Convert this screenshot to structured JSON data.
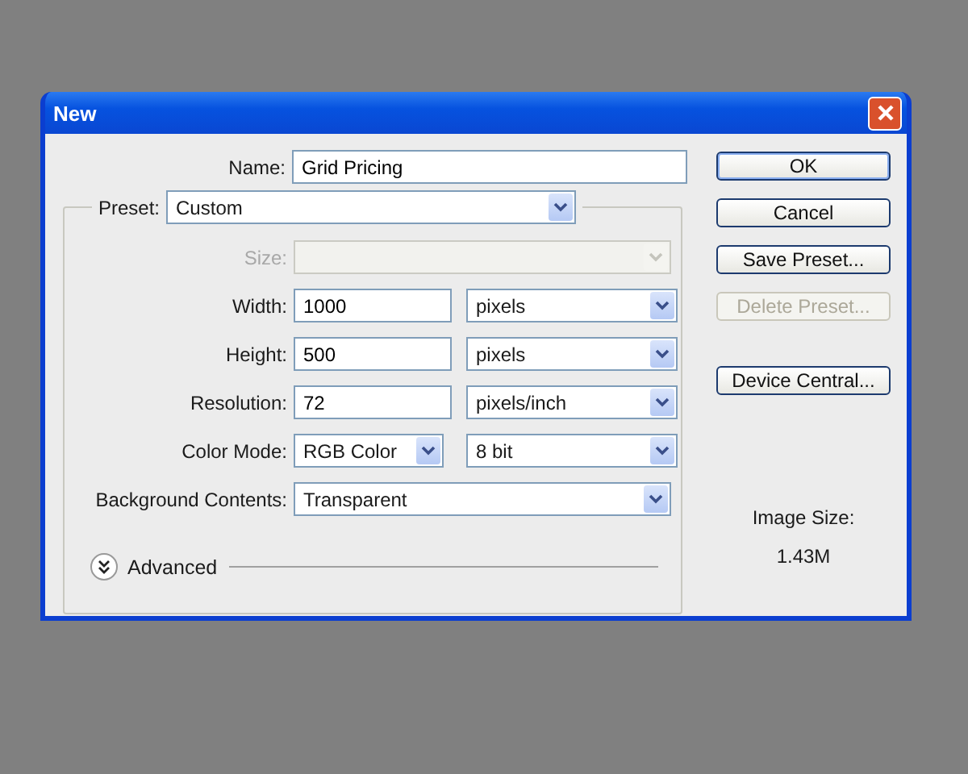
{
  "window": {
    "title": "New"
  },
  "name": {
    "label": "Name:",
    "value": "Grid Pricing"
  },
  "preset": {
    "label": "Preset:",
    "value": "Custom"
  },
  "rows": [
    {
      "kind": "select",
      "label": "Size:",
      "disabled": true
    },
    {
      "kind": "number",
      "label": "Width:",
      "value": "1000",
      "unit": "pixels",
      "disabled": false
    },
    {
      "kind": "number",
      "label": "Height:",
      "value": "500",
      "unit": "pixels",
      "disabled": false
    },
    {
      "kind": "number",
      "label": "Resolution:",
      "value": "72",
      "unit": "pixels/inch",
      "disabled": false
    },
    {
      "kind": "pair",
      "label": "Color Mode:",
      "value": "RGB Color",
      "unit": "8 bit",
      "disabled": false
    },
    {
      "kind": "select",
      "label": "Background Contents:",
      "value": "Transparent",
      "disabled": false
    }
  ],
  "advanced": {
    "label": "Advanced",
    "expanded": false
  },
  "buttons": [
    {
      "label": "OK",
      "disabled": false,
      "default": true
    },
    {
      "label": "Cancel",
      "disabled": false,
      "default": false
    },
    {
      "label": "Save Preset...",
      "disabled": false,
      "default": false
    },
    {
      "label": "Delete Preset...",
      "disabled": true,
      "default": false
    },
    {
      "label": "Device Central...",
      "disabled": false,
      "default": false
    }
  ],
  "image_size": {
    "label": "Image Size:",
    "value": "1.43M"
  }
}
